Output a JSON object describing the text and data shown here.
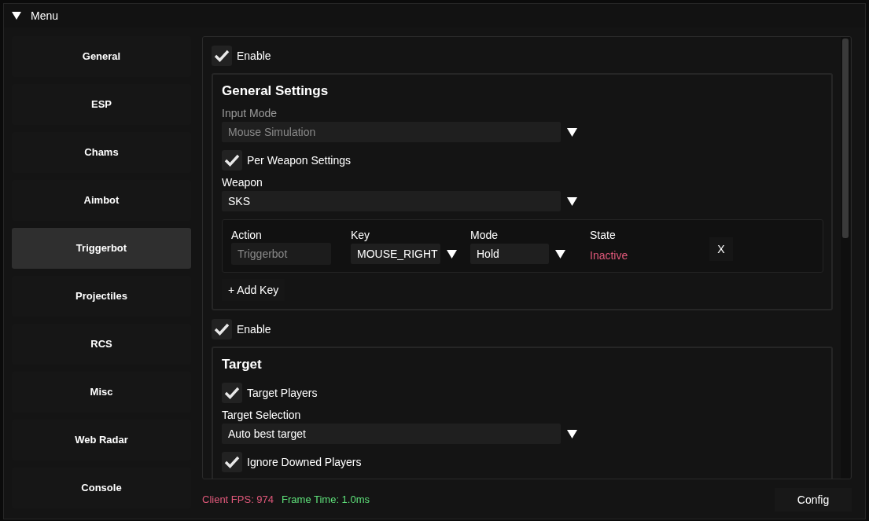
{
  "window": {
    "title": "Menu",
    "expanded": true
  },
  "sidebar": {
    "items": [
      {
        "label": "General",
        "selected": false
      },
      {
        "label": "ESP",
        "selected": false
      },
      {
        "label": "Chams",
        "selected": false
      },
      {
        "label": "Aimbot",
        "selected": false
      },
      {
        "label": "Triggerbot",
        "selected": true
      },
      {
        "label": "Projectiles",
        "selected": false
      },
      {
        "label": "RCS",
        "selected": false
      },
      {
        "label": "Misc",
        "selected": false
      },
      {
        "label": "Web Radar",
        "selected": false
      },
      {
        "label": "Console",
        "selected": false
      }
    ]
  },
  "content": {
    "sections": [
      {
        "enable": {
          "label": "Enable",
          "checked": true
        },
        "group": {
          "title": "General Settings",
          "controls": [
            {
              "kind": "dropdown",
              "label": "Input Mode",
              "value": "Mouse Simulation",
              "disabled": true
            },
            {
              "kind": "checkbox",
              "label": "Per Weapon Settings",
              "checked": true
            },
            {
              "kind": "dropdown",
              "label": "Weapon",
              "value": "SKS",
              "disabled": false
            },
            {
              "kind": "keybinds",
              "columns": [
                "Action",
                "Key",
                "Mode",
                "State"
              ],
              "rows": [
                {
                  "action": "Triggerbot",
                  "key": "MOUSE_RIGHT",
                  "mode": "Hold",
                  "state": "Inactive",
                  "active": false,
                  "remove": "X"
                }
              ],
              "add_button": "+ Add Key"
            }
          ]
        }
      },
      {
        "enable": {
          "label": "Enable",
          "checked": true
        },
        "group": {
          "title": "Target",
          "controls": [
            {
              "kind": "checkbox",
              "label": "Target Players",
              "checked": true
            },
            {
              "kind": "dropdown",
              "label": "Target Selection",
              "value": "Auto best target",
              "disabled": false
            },
            {
              "kind": "checkbox",
              "label": "Ignore Downed Players",
              "checked": true
            }
          ]
        }
      }
    ]
  },
  "status": {
    "fps": "Client FPS: 974",
    "frame_time": "Frame Time: 1.0ms"
  },
  "config_button": "Config"
}
